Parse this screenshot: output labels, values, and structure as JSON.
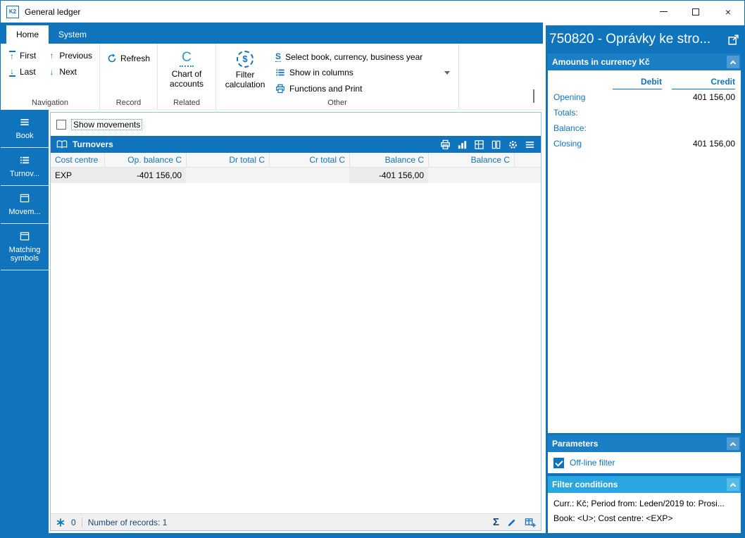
{
  "window": {
    "title": "General ledger",
    "app_icon": "K2"
  },
  "icons": {
    "sigma": "Σ",
    "dollar": "$",
    "close": "×",
    "arrow_up": "↑",
    "arrow_down": "↓"
  },
  "tabs": [
    {
      "label": "Home"
    },
    {
      "label": "System"
    }
  ],
  "ribbon": {
    "nav": {
      "first": "First",
      "previous": "Previous",
      "last": "Last",
      "next": "Next",
      "group_label": "Navigation"
    },
    "record": {
      "refresh": "Refresh",
      "group_label": "Record"
    },
    "related": {
      "chart_of_accounts": "Chart of accounts",
      "icon_letter": "C",
      "group_label": "Related"
    },
    "other": {
      "filter_calculation": "Filter calculation",
      "select_book": "Select book, currency, business year",
      "select_icon_letter": "S",
      "show_in_columns": "Show in columns",
      "functions_and_print": "Functions and Print",
      "group_label": "Other"
    }
  },
  "sidebar": {
    "items": [
      {
        "label": "Book"
      },
      {
        "label": "Turnov..."
      },
      {
        "label": "Movem..."
      },
      {
        "label": "Matching symbols"
      }
    ]
  },
  "main": {
    "show_movements": "Show movements",
    "panel_title": "Turnovers",
    "table": {
      "columns": [
        "Cost centre",
        "Op. balance C",
        "Dr total C",
        "Cr total C",
        "Balance C",
        "Balance C"
      ],
      "row": {
        "cost_centre": "EXP",
        "op_balance": "-401 156,00",
        "dr_total": "",
        "cr_total": "",
        "balance1": "-401 156,00",
        "balance2": ""
      }
    },
    "status": {
      "count": "0",
      "records": "Number of records: 1"
    }
  },
  "right": {
    "title": "750820 - Oprávky ke stro...",
    "amounts": {
      "header": "Amounts in currency Kč",
      "debit_label": "Debit",
      "credit_label": "Credit",
      "rows": [
        {
          "label": "Opening",
          "debit": "",
          "credit": "401 156,00"
        },
        {
          "label": "Totals:",
          "debit": "",
          "credit": ""
        },
        {
          "label": "Balance:",
          "debit": "",
          "credit": ""
        },
        {
          "label": "Closing",
          "debit": "",
          "credit": "401 156,00"
        }
      ]
    },
    "parameters": {
      "header": "Parameters",
      "offline_filter": "Off-line filter"
    },
    "filter_conditions": {
      "header": "Filter conditions",
      "line1": "Curr.: Kč; Period from: Leden/2019 to: Prosi...",
      "line2": "Book: <U>; Cost centre: <EXP>"
    }
  },
  "colors": {
    "primary_blue": "#1074bc",
    "light_blue": "#2aa7e1"
  }
}
